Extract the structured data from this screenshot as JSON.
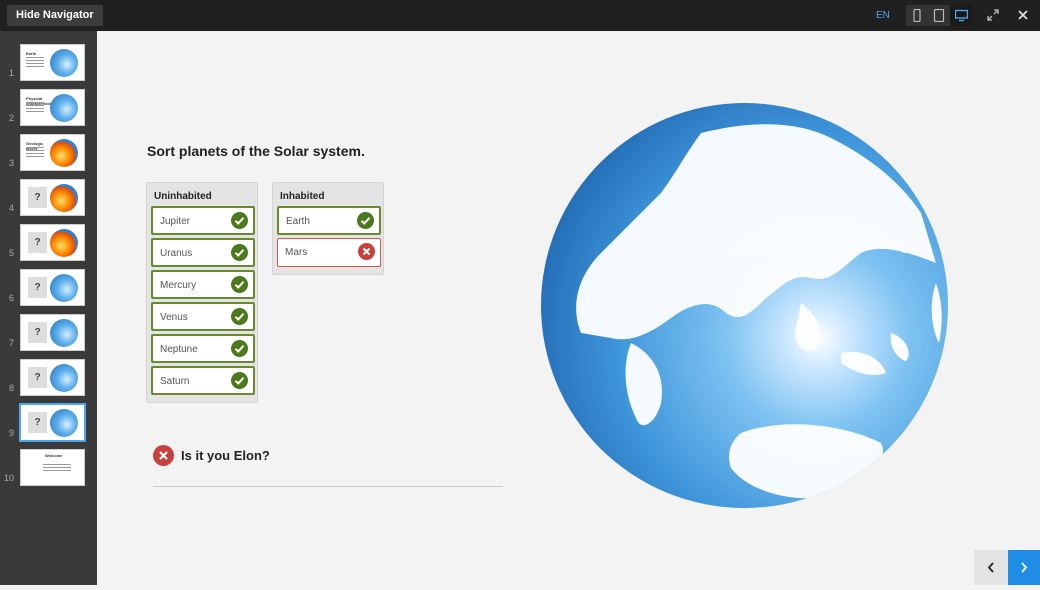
{
  "topbar": {
    "hide_navigator": "Hide Navigator",
    "language": "EN",
    "device_icons": [
      "phone-icon",
      "tablet-icon",
      "desktop-icon"
    ],
    "active_device": "desktop",
    "accent": "#4aa8f0"
  },
  "navigator": {
    "slides": [
      {
        "num": "1",
        "title": "Earth",
        "kind": "text-globe"
      },
      {
        "num": "2",
        "title": "Physical characteristics",
        "kind": "text-globe"
      },
      {
        "num": "3",
        "title": "Geologic layers",
        "kind": "text-core"
      },
      {
        "num": "4",
        "title": "",
        "kind": "question-core"
      },
      {
        "num": "5",
        "title": "",
        "kind": "question-core"
      },
      {
        "num": "6",
        "title": "",
        "kind": "question-globe"
      },
      {
        "num": "7",
        "title": "",
        "kind": "question-globe"
      },
      {
        "num": "8",
        "title": "",
        "kind": "question-globe"
      },
      {
        "num": "9",
        "title": "",
        "kind": "question-globe",
        "active": true
      },
      {
        "num": "10",
        "title": "Welcome",
        "kind": "summary"
      }
    ],
    "question_mark": "?"
  },
  "main": {
    "title": "Sort planets of the Solar system.",
    "uninhabited": {
      "header": "Uninhabited",
      "items": [
        {
          "label": "Jupiter",
          "correct": true
        },
        {
          "label": "Uranus",
          "correct": true
        },
        {
          "label": "Mercury",
          "correct": true
        },
        {
          "label": "Venus",
          "correct": true
        },
        {
          "label": "Neptune",
          "correct": true
        },
        {
          "label": "Saturn",
          "correct": true
        }
      ]
    },
    "inhabited": {
      "header": "Inhabited",
      "items": [
        {
          "label": "Earth",
          "correct": true
        },
        {
          "label": "Mars",
          "correct": false
        }
      ]
    },
    "feedback": "Is it you Elon?",
    "colors": {
      "correct": "#4a7a1c",
      "wrong": "#c8403c"
    }
  },
  "footer": {
    "prev_icon": "chevron-left-icon",
    "next_icon": "chevron-right-icon",
    "next_color": "#1f8ce6"
  }
}
